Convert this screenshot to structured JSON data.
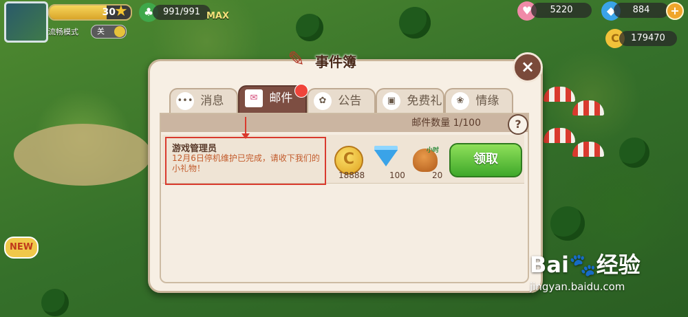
{
  "hud": {
    "level": "30",
    "smooth_mode_label": "流畅模式",
    "smooth_toggle": "关",
    "energy": "991/991",
    "max_label": "MAX",
    "hearts": "5220",
    "gems": "884",
    "coins": "179470"
  },
  "new_badge": "NEW",
  "dialog": {
    "title": "事件簿",
    "close": "×",
    "tabs": [
      {
        "label": "消息",
        "icon": "chat-icon",
        "glyph": "•••"
      },
      {
        "label": "邮件",
        "icon": "envelope-icon",
        "glyph": "✉"
      },
      {
        "label": "公告",
        "icon": "flower-icon",
        "glyph": "✿"
      },
      {
        "label": "免费礼物",
        "icon": "gift-icon",
        "glyph": "▣"
      },
      {
        "label": "情缘",
        "icon": "flower-icon",
        "glyph": "❀"
      }
    ],
    "mail_count": "邮件数量 1/100",
    "help": "?",
    "mail": {
      "sender": "游戏管理员",
      "message": "12月6日停机维护已完成，请收下我们的小礼物！",
      "rewards": [
        {
          "type": "coin",
          "qty": "18888"
        },
        {
          "type": "gem",
          "qty": "100"
        },
        {
          "type": "fertilizer",
          "qty": "20",
          "tag": "小时"
        }
      ],
      "claim_label": "领取"
    }
  },
  "watermark": {
    "brand": "Bai🐾经验",
    "url": "jingyan.baidu.com"
  },
  "colors": {
    "accent_brown": "#7d4e42",
    "claim_green": "#3fa82a",
    "highlight_red": "#d93a2e"
  }
}
